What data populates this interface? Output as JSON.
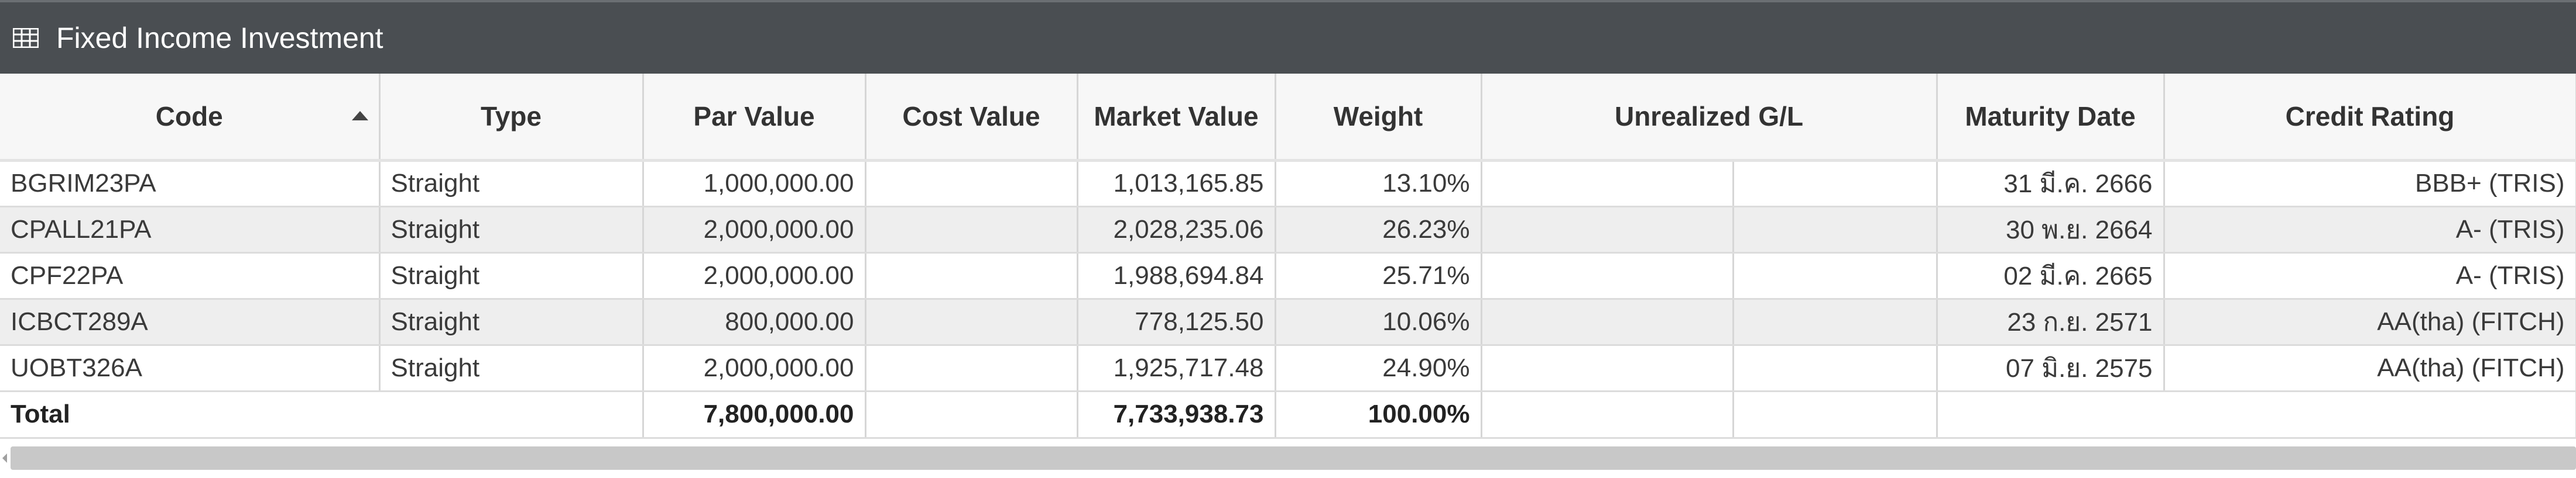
{
  "panel": {
    "title": "Fixed Income Investment",
    "icon": "table-icon"
  },
  "columns": {
    "code": "Code",
    "type": "Type",
    "par_value": "Par Value",
    "cost_value": "Cost Value",
    "market_value": "Market Value",
    "weight": "Weight",
    "unrealized_gl": "Unrealized G/L",
    "maturity_date": "Maturity Date",
    "credit_rating": "Credit Rating"
  },
  "rows": [
    {
      "code": "BGRIM23PA",
      "type": "Straight",
      "par_value": "1,000,000.00",
      "cost_value": "",
      "market_value": "1,013,165.85",
      "weight": "13.10%",
      "gl_a": "",
      "gl_b": "",
      "maturity_date": "31 มี.ค. 2666",
      "credit_rating": "BBB+ (TRIS)"
    },
    {
      "code": "CPALL21PA",
      "type": "Straight",
      "par_value": "2,000,000.00",
      "cost_value": "",
      "market_value": "2,028,235.06",
      "weight": "26.23%",
      "gl_a": "",
      "gl_b": "",
      "maturity_date": "30 พ.ย. 2664",
      "credit_rating": "A- (TRIS)"
    },
    {
      "code": "CPF22PA",
      "type": "Straight",
      "par_value": "2,000,000.00",
      "cost_value": "",
      "market_value": "1,988,694.84",
      "weight": "25.71%",
      "gl_a": "",
      "gl_b": "",
      "maturity_date": "02 มี.ค. 2665",
      "credit_rating": "A- (TRIS)"
    },
    {
      "code": "ICBCT289A",
      "type": "Straight",
      "par_value": "800,000.00",
      "cost_value": "",
      "market_value": "778,125.50",
      "weight": "10.06%",
      "gl_a": "",
      "gl_b": "",
      "maturity_date": "23 ก.ย. 2571",
      "credit_rating": "AA(tha) (FITCH)"
    },
    {
      "code": "UOBT326A",
      "type": "Straight",
      "par_value": "2,000,000.00",
      "cost_value": "",
      "market_value": "1,925,717.48",
      "weight": "24.90%",
      "gl_a": "",
      "gl_b": "",
      "maturity_date": "07 มิ.ย. 2575",
      "credit_rating": "AA(tha) (FITCH)"
    }
  ],
  "total": {
    "label": "Total",
    "par_value": "7,800,000.00",
    "market_value": "7,733,938.73",
    "weight": "100.00%"
  },
  "sort": {
    "column": "code",
    "direction": "ascending"
  }
}
